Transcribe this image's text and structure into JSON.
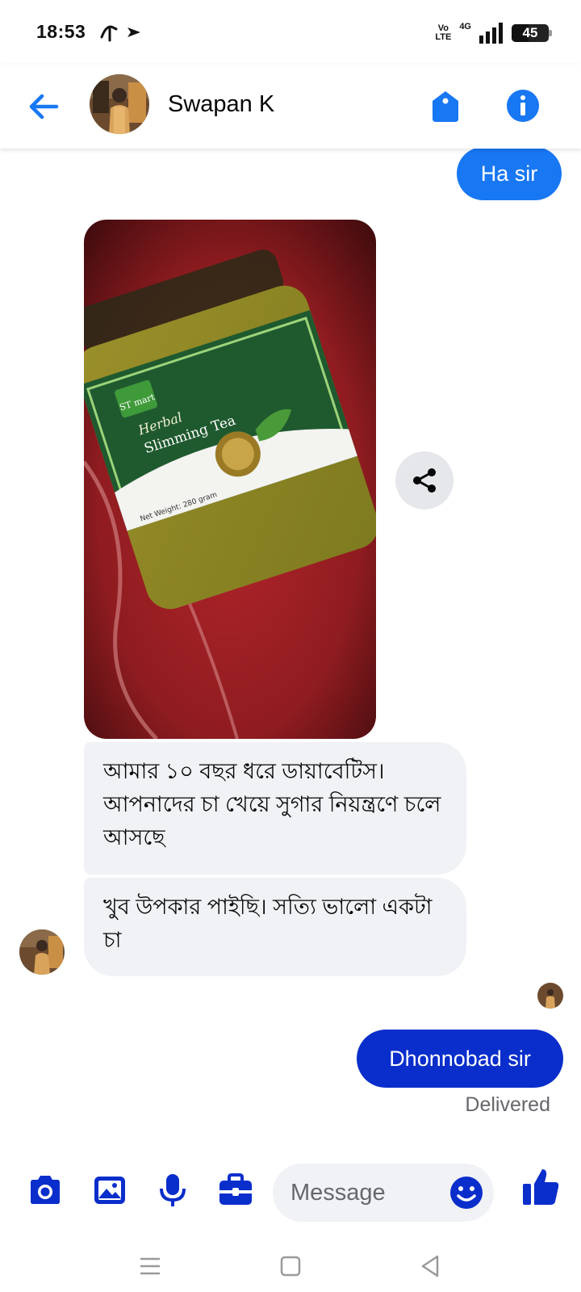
{
  "status_bar": {
    "time": "18:53",
    "volte_top": "Vo",
    "volte_bottom": "LTE",
    "network": "4G",
    "battery": "45",
    "battery_level": 0.45
  },
  "header": {
    "contact_name": "Swapan K"
  },
  "messages": {
    "m1": "Ha sir",
    "m3": "আমার ১০ বছর ধরে ডায়াবেটিস। আপনাদের চা খেয়ে সুগার নিয়ন্ত্রণে চলে আসছে",
    "m4": "খুব উপকার পাইছি। সত্যি ভালো একটা চা",
    "m5": "Dhonnobad sir",
    "status": "Delivered"
  },
  "photo": {
    "brand": "ST mart",
    "line1": "Herbal",
    "line2": "Slimming Tea",
    "weight": "Net Weight: 280 gram"
  },
  "composer": {
    "placeholder": "Message"
  },
  "colors": {
    "accent": "#1877f2",
    "sent_bubble": "#0a2ecb",
    "received_bubble": "#f0f2f5",
    "icon_blue": "#0a2ecb"
  }
}
